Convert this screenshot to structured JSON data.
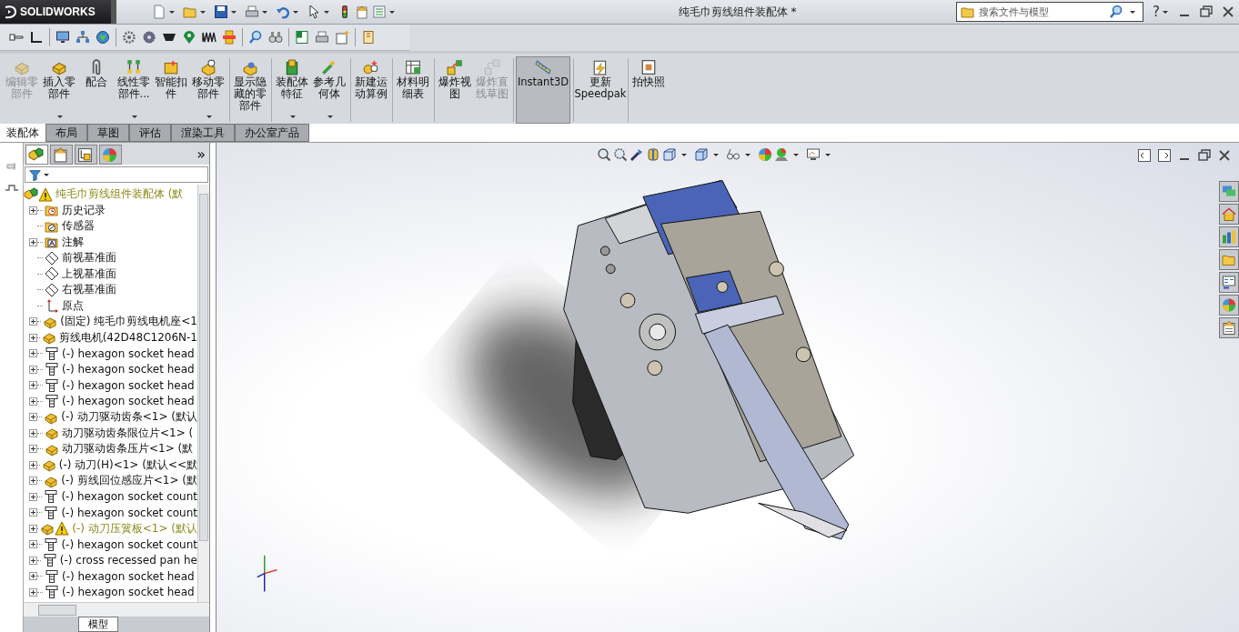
{
  "title_bar": {
    "logo": "SOLIDWORKS",
    "title": "纯毛巾剪线组件装配体 *",
    "search": {
      "placeholder": "搜索文件与模型"
    },
    "help": "?"
  },
  "ribbon": {
    "groups": [
      [
        {
          "label": "编辑零部件",
          "disabled": true,
          "selected": false,
          "dropdown": false
        },
        {
          "label": "插入零部件",
          "disabled": false,
          "selected": false,
          "dropdown": true
        },
        {
          "label": "配合",
          "disabled": false,
          "selected": false,
          "dropdown": false
        },
        {
          "label": "线性零部件...",
          "disabled": false,
          "selected": false,
          "dropdown": true
        },
        {
          "label": "智能扣件",
          "disabled": false,
          "selected": false,
          "dropdown": false
        },
        {
          "label": "移动零部件",
          "disabled": false,
          "selected": false,
          "dropdown": true
        }
      ],
      [
        {
          "label": "显示隐藏的零部件",
          "disabled": false,
          "selected": false,
          "dropdown": false
        }
      ],
      [
        {
          "label": "装配体特征",
          "disabled": false,
          "selected": false,
          "dropdown": true
        },
        {
          "label": "参考几何体",
          "disabled": false,
          "selected": false,
          "dropdown": true
        }
      ],
      [
        {
          "label": "新建运动算例",
          "disabled": false,
          "selected": false,
          "dropdown": false
        }
      ],
      [
        {
          "label": "材料明细表",
          "disabled": false,
          "selected": false,
          "dropdown": false
        }
      ],
      [
        {
          "label": "爆炸视图",
          "disabled": false,
          "selected": false,
          "dropdown": false
        },
        {
          "label": "爆炸直线草图",
          "disabled": true,
          "selected": false,
          "dropdown": false
        }
      ],
      [
        {
          "label": "Instant3D",
          "disabled": false,
          "selected": true,
          "dropdown": false
        }
      ],
      [
        {
          "label": "更新Speedpak",
          "disabled": false,
          "selected": false,
          "dropdown": false
        }
      ],
      [
        {
          "label": "拍快照",
          "disabled": false,
          "selected": false,
          "dropdown": false
        }
      ]
    ]
  },
  "tabs": [
    {
      "label": "装配体",
      "selected": true
    },
    {
      "label": "布局",
      "selected": false
    },
    {
      "label": "草图",
      "selected": false
    },
    {
      "label": "评估",
      "selected": false
    },
    {
      "label": "渲染工具",
      "selected": false
    },
    {
      "label": "办公室产品",
      "selected": false
    }
  ],
  "tree_panel": {
    "more": "»",
    "bottom_tabs": [
      {
        "label": "模型",
        "selected": true
      }
    ],
    "tree": {
      "label": "纯毛巾剪线组件装配体 (默",
      "kind": "assembly",
      "warning": true,
      "expandable": false,
      "children": [
        {
          "label": "历史记录",
          "kind": "history",
          "warning": false,
          "expandable": true
        },
        {
          "label": "传感器",
          "kind": "sensor",
          "warning": false,
          "expandable": false
        },
        {
          "label": "注解",
          "kind": "annotation",
          "warning": false,
          "expandable": true
        },
        {
          "label": "前视基准面",
          "kind": "plane",
          "warning": false,
          "expandable": false
        },
        {
          "label": "上视基准面",
          "kind": "plane",
          "warning": false,
          "expandable": false
        },
        {
          "label": "右视基准面",
          "kind": "plane",
          "warning": false,
          "expandable": false
        },
        {
          "label": "原点",
          "kind": "origin",
          "warning": false,
          "expandable": false
        },
        {
          "label": "(固定) 纯毛巾剪线电机座<1",
          "kind": "part",
          "warning": false,
          "expandable": true
        },
        {
          "label": "剪线电机(42D48C1206N-1",
          "kind": "part",
          "warning": false,
          "expandable": true
        },
        {
          "label": "(-) hexagon socket head",
          "kind": "screw",
          "warning": false,
          "expandable": true
        },
        {
          "label": "(-) hexagon socket head",
          "kind": "screw",
          "warning": false,
          "expandable": true
        },
        {
          "label": "(-) hexagon socket head",
          "kind": "screw",
          "warning": false,
          "expandable": true
        },
        {
          "label": "(-) hexagon socket head",
          "kind": "screw",
          "warning": false,
          "expandable": true
        },
        {
          "label": "(-) 动刀驱动齿条<1> (默认",
          "kind": "part",
          "warning": false,
          "expandable": true
        },
        {
          "label": "动刀驱动齿条限位片<1> (",
          "kind": "part",
          "warning": false,
          "expandable": true
        },
        {
          "label": "动刀驱动齿条压片<1> (默",
          "kind": "part",
          "warning": false,
          "expandable": true
        },
        {
          "label": "(-) 动刀(H)<1> (默认<<默",
          "kind": "part",
          "warning": false,
          "expandable": true
        },
        {
          "label": "(-) 剪线回位感应片<1> (默",
          "kind": "part",
          "warning": false,
          "expandable": true
        },
        {
          "label": "(-) hexagon socket count",
          "kind": "screw",
          "warning": false,
          "expandable": true
        },
        {
          "label": "(-) hexagon socket count",
          "kind": "screw",
          "warning": false,
          "expandable": true
        },
        {
          "label": "(-) 动刀压簧板<1> (默认",
          "kind": "part",
          "warning": true,
          "expandable": true
        },
        {
          "label": "(-) hexagon socket count",
          "kind": "screw",
          "warning": false,
          "expandable": true
        },
        {
          "label": "(-) cross recessed pan he",
          "kind": "screw",
          "warning": false,
          "expandable": true
        },
        {
          "label": "(-) hexagon socket head",
          "kind": "screw",
          "warning": false,
          "expandable": true
        },
        {
          "label": "(-) hexagon socket head",
          "kind": "screw",
          "warning": false,
          "expandable": true
        }
      ]
    }
  }
}
